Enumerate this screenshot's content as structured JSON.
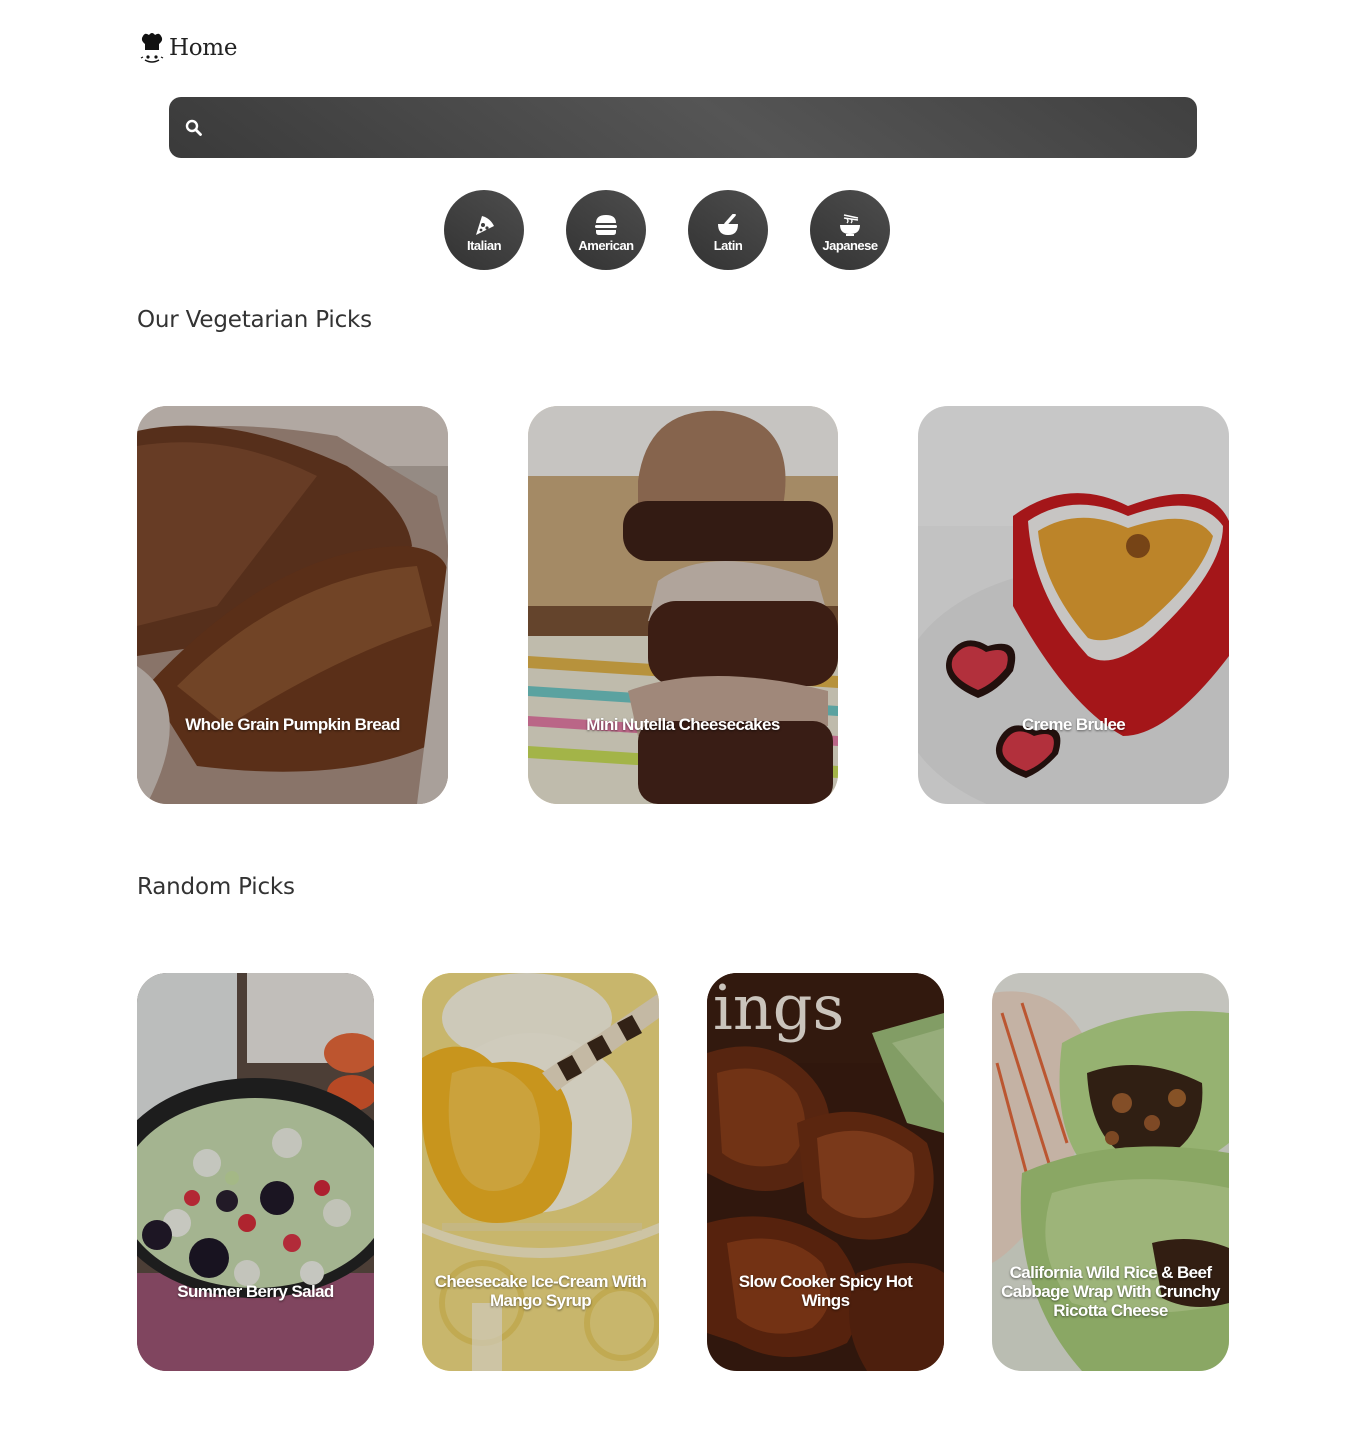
{
  "nav": {
    "home_label": "Home",
    "logo_icon": "chef-hat-icon"
  },
  "search": {
    "placeholder": "",
    "value": "",
    "icon": "search-icon"
  },
  "cuisines": [
    {
      "label": "Italian",
      "icon": "pizza-icon"
    },
    {
      "label": "American",
      "icon": "burger-icon"
    },
    {
      "label": "Latin",
      "icon": "mortar-pestle-icon"
    },
    {
      "label": "Japanese",
      "icon": "ramen-bowl-icon"
    }
  ],
  "vegetarian": {
    "title": "Our Vegetarian Picks",
    "items": [
      {
        "name": "Whole Grain Pumpkin Bread"
      },
      {
        "name": "Mini Nutella Cheesecakes"
      },
      {
        "name": "Creme Brulee"
      }
    ]
  },
  "random": {
    "title": "Random Picks",
    "items": [
      {
        "name": "Summer Berry Salad"
      },
      {
        "name": "Cheesecake Ice-Cream With Mango Syrup"
      },
      {
        "name": "Slow Cooker Spicy Hot Wings"
      },
      {
        "name": "California Wild Rice & Beef Cabbage Wrap With Crunchy Ricotta Cheese"
      }
    ],
    "photo_text": {
      "wings": "ings"
    }
  },
  "colors": {
    "dark_ui": "#3d3d3d",
    "text": "#333333",
    "caption": "#ffffff"
  }
}
